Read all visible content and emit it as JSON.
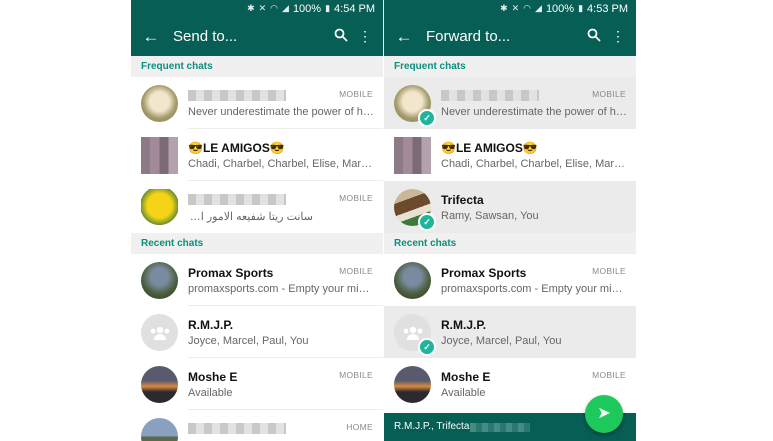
{
  "left": {
    "status": {
      "time": "4:54 PM",
      "battery": "100%"
    },
    "title": "Send to...",
    "frequent_label": "Frequent chats",
    "recent_label": "Recent chats",
    "frequent": [
      {
        "name": "",
        "tag": "MOBILE",
        "sub": "Never underestimate the power of hu..."
      },
      {
        "name": "😎LE AMIGOS😎",
        "tag": "",
        "sub": "Chadi, Charbel, Charbel, Elise, Marcel,..."
      },
      {
        "name": "",
        "tag": "MOBILE",
        "sub": "سانت ريتا شفيعه الامور المستحيله"
      }
    ],
    "recent": [
      {
        "name": "Promax Sports",
        "tag": "MOBILE",
        "sub": "promaxsports.com - Empty your mind,..."
      },
      {
        "name": "R.M.J.P.",
        "tag": "",
        "sub": "Joyce, Marcel, Paul, You"
      },
      {
        "name": "Moshe E",
        "tag": "MOBILE",
        "sub": "Available"
      },
      {
        "name": "",
        "tag": "HOME",
        "sub": ""
      }
    ]
  },
  "right": {
    "status": {
      "time": "4:53 PM",
      "battery": "100%"
    },
    "title": "Forward to...",
    "frequent_label": "Frequent chats",
    "recent_label": "Recent chats",
    "frequent": [
      {
        "name": "",
        "tag": "MOBILE",
        "sub": "Never underestimate the power of hu..."
      },
      {
        "name": "😎LE AMIGOS😎",
        "tag": "",
        "sub": "Chadi, Charbel, Charbel, Elise, Marcel,..."
      },
      {
        "name": "Trifecta",
        "tag": "",
        "sub": "Ramy, Sawsan, You"
      }
    ],
    "recent": [
      {
        "name": "Promax Sports",
        "tag": "MOBILE",
        "sub": "promaxsports.com - Empty your mind,..."
      },
      {
        "name": "R.M.J.P.",
        "tag": "",
        "sub": "Joyce, Marcel, Paul, You"
      },
      {
        "name": "Moshe E",
        "tag": "MOBILE",
        "sub": "Available"
      }
    ],
    "selected_recipients": "R.M.J.P., Trifecta,"
  },
  "icons": {
    "back": "arrow-back-icon",
    "search": "search-icon",
    "more": "more-vert-icon",
    "send": "send-icon",
    "check": "check-icon",
    "group": "group-icon"
  },
  "colors": {
    "header": "#075e54",
    "accent": "#0c8f7c",
    "check": "#1eb59a",
    "fab": "#1ec95c"
  }
}
